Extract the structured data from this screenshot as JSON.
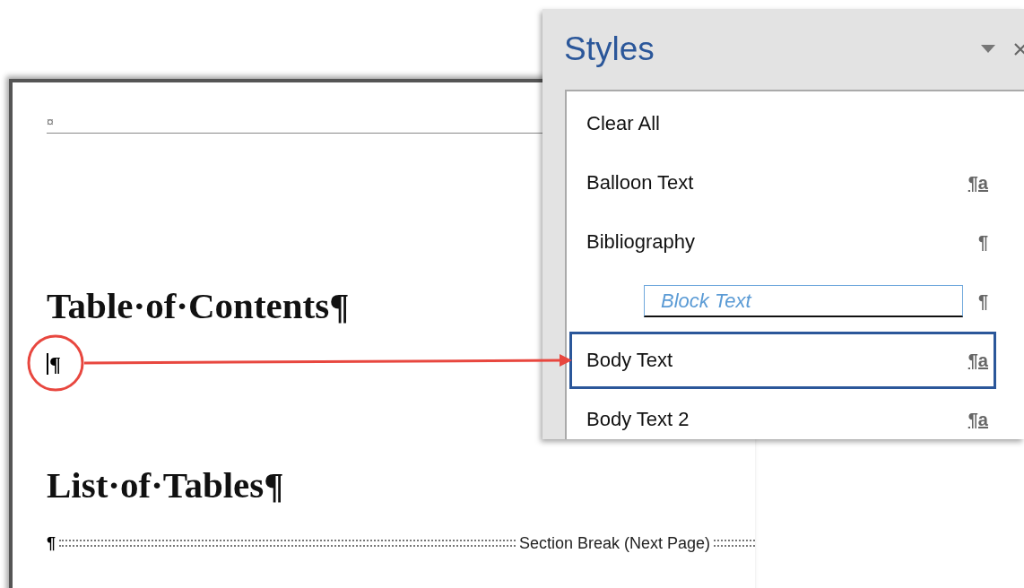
{
  "document": {
    "header_mark": "¤",
    "paragraphs": [
      {
        "kind": "heading",
        "text": "Table·of·Contents¶"
      },
      {
        "kind": "empty",
        "text": "¶",
        "cursor": true
      },
      {
        "kind": "heading",
        "text": "List·of·Tables¶"
      },
      {
        "kind": "section_break",
        "mark": "¶",
        "text": "Section Break (Next Page)"
      }
    ]
  },
  "styles_pane": {
    "title": "Styles",
    "items": [
      {
        "kind": "plain",
        "name": "Clear All",
        "selected": false
      },
      {
        "kind": "plain",
        "name": "Balloon Text",
        "mark": "¶a",
        "linked": true,
        "selected": false
      },
      {
        "kind": "plain",
        "name": "Bibliography",
        "mark": "¶",
        "linked": false,
        "selected": false
      },
      {
        "kind": "editing",
        "name": "Block Text",
        "mark": "¶",
        "linked": false,
        "selected": false
      },
      {
        "kind": "plain",
        "name": "Body Text",
        "mark": "¶a",
        "linked": true,
        "selected": true
      },
      {
        "kind": "plain",
        "name": "Body Text 2",
        "mark": "¶a",
        "linked": true,
        "selected": false
      }
    ]
  }
}
